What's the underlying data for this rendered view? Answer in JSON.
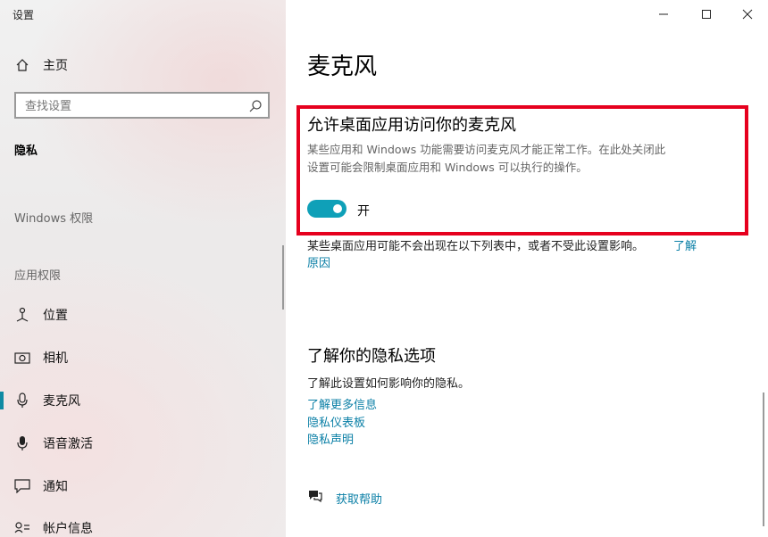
{
  "window": {
    "title": "设置"
  },
  "window_controls": {
    "minimize": "—",
    "maximize": "☐",
    "close": "✕"
  },
  "sidebar": {
    "home_label": "主页",
    "search_placeholder": "查找设置",
    "section_privacy": "隐私",
    "section_windows_permissions": "Windows 权限",
    "section_app_permissions": "应用权限",
    "items": [
      {
        "label": "位置",
        "icon": "location-icon"
      },
      {
        "label": "相机",
        "icon": "camera-icon"
      },
      {
        "label": "麦克风",
        "icon": "microphone-icon",
        "active": true
      },
      {
        "label": "语音激活",
        "icon": "voice-activation-icon"
      },
      {
        "label": "通知",
        "icon": "notification-icon"
      },
      {
        "label": "帐户信息",
        "icon": "account-info-icon"
      }
    ]
  },
  "main": {
    "page_title": "麦克风",
    "desktop_section": {
      "heading": "允许桌面应用访问你的麦克风",
      "desc_line1": "某些应用和 Windows 功能需要访问麦克风才能正常工作。在此处关闭此",
      "desc_line2": "设置可能会限制桌面应用和 Windows 可以执行的操作。",
      "toggle_state": "开",
      "toggle_on": true
    },
    "note_line1": "某些桌面应用可能不会出现在以下列表中，或者不受此设置影响。",
    "note_link_part1": "了解",
    "note_link_part2": "原因",
    "privacy_section": {
      "heading": "了解你的隐私选项",
      "desc": "了解此设置如何影响你的隐私。",
      "links": [
        "了解更多信息",
        "隐私仪表板",
        "隐私声明"
      ]
    },
    "help_link": "获取帮助"
  },
  "colors": {
    "accent": "#0fa0b8",
    "highlight_border": "#e6001e",
    "link": "#0a7fa6"
  }
}
